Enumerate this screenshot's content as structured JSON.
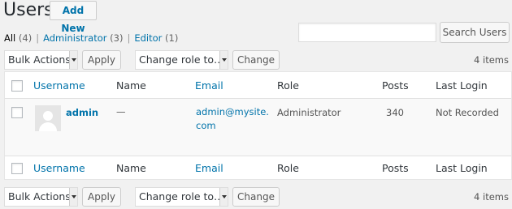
{
  "header": {
    "title": "Users",
    "add_new_label": "Add New"
  },
  "filters": {
    "all": {
      "label": "All",
      "count": "(4)"
    },
    "administrator": {
      "label": "Administrator",
      "count": "(3)"
    },
    "editor": {
      "label": "Editor",
      "count": "(1)"
    },
    "separator": "|"
  },
  "search": {
    "value": "",
    "button_label": "Search Users"
  },
  "tablenav_top": {
    "bulk_actions": "Bulk Actions",
    "apply_label": "Apply",
    "change_role": "Change role to…",
    "change_label": "Change",
    "items_count": "4 items"
  },
  "tablenav_bottom": {
    "bulk_actions": "Bulk Actions",
    "apply_label": "Apply",
    "change_role": "Change role to…",
    "change_label": "Change",
    "items_count": "4 items"
  },
  "table": {
    "columns": {
      "username": "Username",
      "name": "Name",
      "email": "Email",
      "role": "Role",
      "posts": "Posts",
      "last_login": "Last Login"
    },
    "rows": [
      {
        "username": "admin",
        "name": "—",
        "email_line1": "admin@mysite.",
        "email_line2": "com",
        "role": "Administrator",
        "posts": "340",
        "last_login": "Not Recorded"
      }
    ]
  },
  "colors": {
    "link": "#0073aa",
    "background": "#f1f1f1",
    "table_bg": "#ffffff",
    "row_bg": "#f9f9f9"
  }
}
